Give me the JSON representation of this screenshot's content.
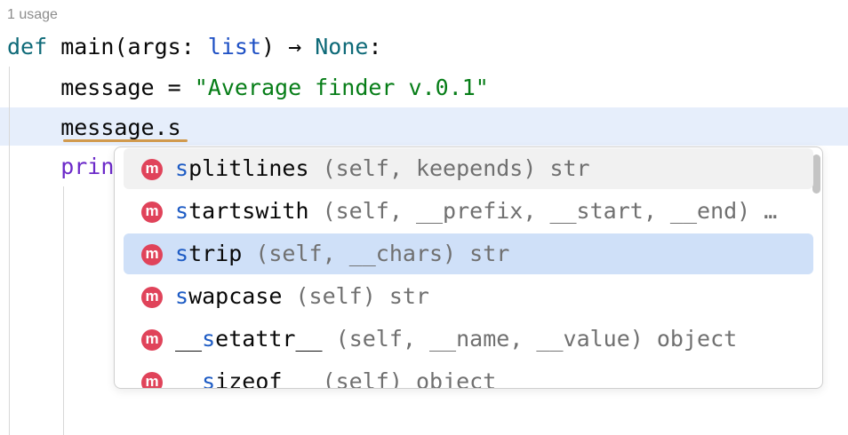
{
  "usage_hint": "1 usage",
  "code": {
    "def_kw": "def",
    "func": "main",
    "params_open": "(args: ",
    "type_list": "list",
    "params_close": ") → ",
    "none": "None",
    "colon": ":",
    "line2_lhs": "    message = ",
    "line2_str": "\"Average finder v.0.1\"",
    "line3": "    message.s",
    "line4": "    prin"
  },
  "completion": {
    "prefix": "s",
    "items": [
      {
        "icon": "m",
        "pre": "",
        "match": "s",
        "rest": "plitlines",
        "sig": " (self, keepends) str",
        "state": "hover"
      },
      {
        "icon": "m",
        "pre": "",
        "match": "s",
        "rest": "tartswith",
        "sig": " (self, __prefix, __start, __end) …",
        "state": ""
      },
      {
        "icon": "m",
        "pre": "",
        "match": "s",
        "rest": "trip",
        "sig": " (self, __chars) str",
        "state": "sel"
      },
      {
        "icon": "m",
        "pre": "",
        "match": "s",
        "rest": "wapcase",
        "sig": " (self) str",
        "state": ""
      },
      {
        "icon": "m",
        "pre": "__",
        "match": "s",
        "rest": "etattr__",
        "sig": " (self, __name, __value) object",
        "state": ""
      },
      {
        "icon": "m",
        "pre": "__",
        "match": "s",
        "rest": "izeof__",
        "sig": " (self) object",
        "state": ""
      }
    ]
  }
}
